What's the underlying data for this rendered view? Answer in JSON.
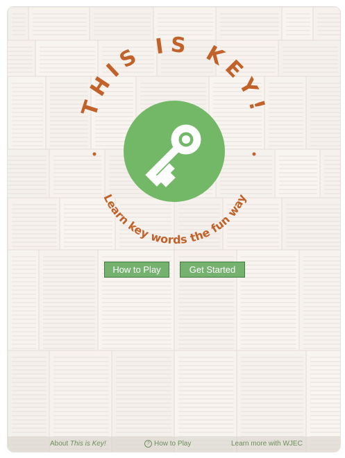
{
  "logo": {
    "title": "THIS IS KEY!",
    "tagline": "Learn key words the fun way",
    "icon": "key-icon",
    "title_color": "#c0622a",
    "circle_color": "#72b866"
  },
  "buttons": {
    "how_to_play": "How to Play",
    "get_started": "Get Started",
    "color": "#76b26f"
  },
  "footer": {
    "about_prefix": "About ",
    "about_name": "This is Key!",
    "how_to_play": "How to Play",
    "help_icon": "question-circle-icon",
    "learn_more": "Learn more with WJEC"
  },
  "background": {
    "image": "open-books-photo"
  }
}
